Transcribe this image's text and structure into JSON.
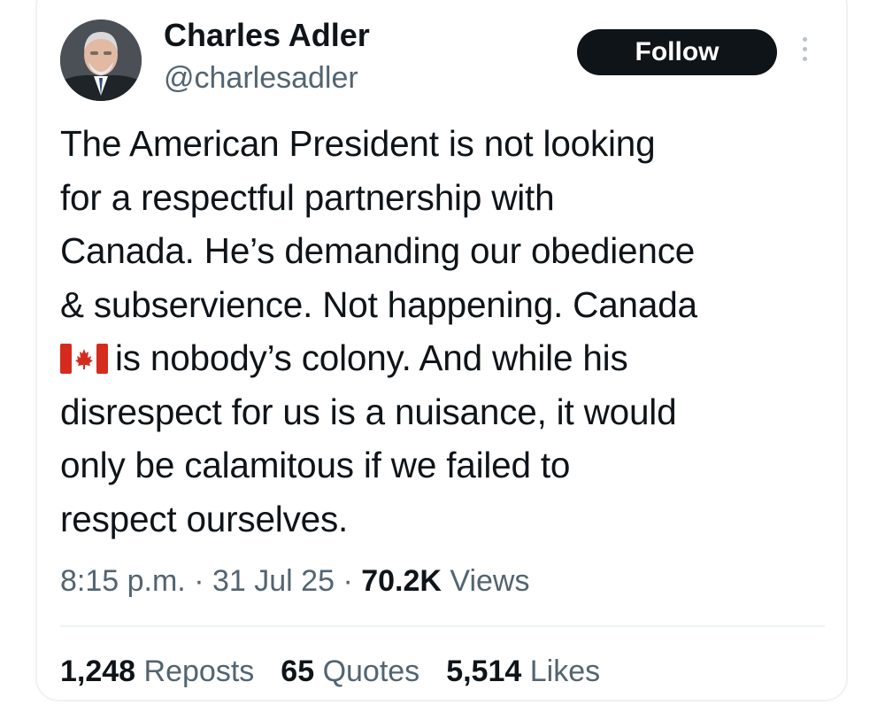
{
  "author": {
    "name": "Charles Adler",
    "handle": "@charlesadler"
  },
  "follow_button": {
    "label": "Follow"
  },
  "more_menu": {
    "icon": "more-vertical-icon"
  },
  "tweet": {
    "lines": [
      "The American President is not looking",
      "for a respectful partnership with",
      "Canada. He’s demanding our obedience",
      "& subservience. Not happening. Canada",
      "is nobody’s colony. And while his",
      "disrespect for us is a nuisance, it would",
      "only be calamitous if we failed to",
      "respect ourselves."
    ],
    "inline_icon": "canada-flag-icon"
  },
  "meta": {
    "time": "8:15 p.m.",
    "separator": "·",
    "date": "31 Jul 25",
    "views_count": "70.2K",
    "views_label": "Views"
  },
  "stats": {
    "reposts_count": "1,248",
    "reposts_label": "Reposts",
    "quotes_count": "65",
    "quotes_label": "Quotes",
    "likes_count": "5,514",
    "likes_label": "Likes"
  },
  "colors": {
    "text": "#0f1419",
    "secondary": "#536471",
    "button_bg": "#0f1419",
    "flag_red": "#d52b1e"
  }
}
